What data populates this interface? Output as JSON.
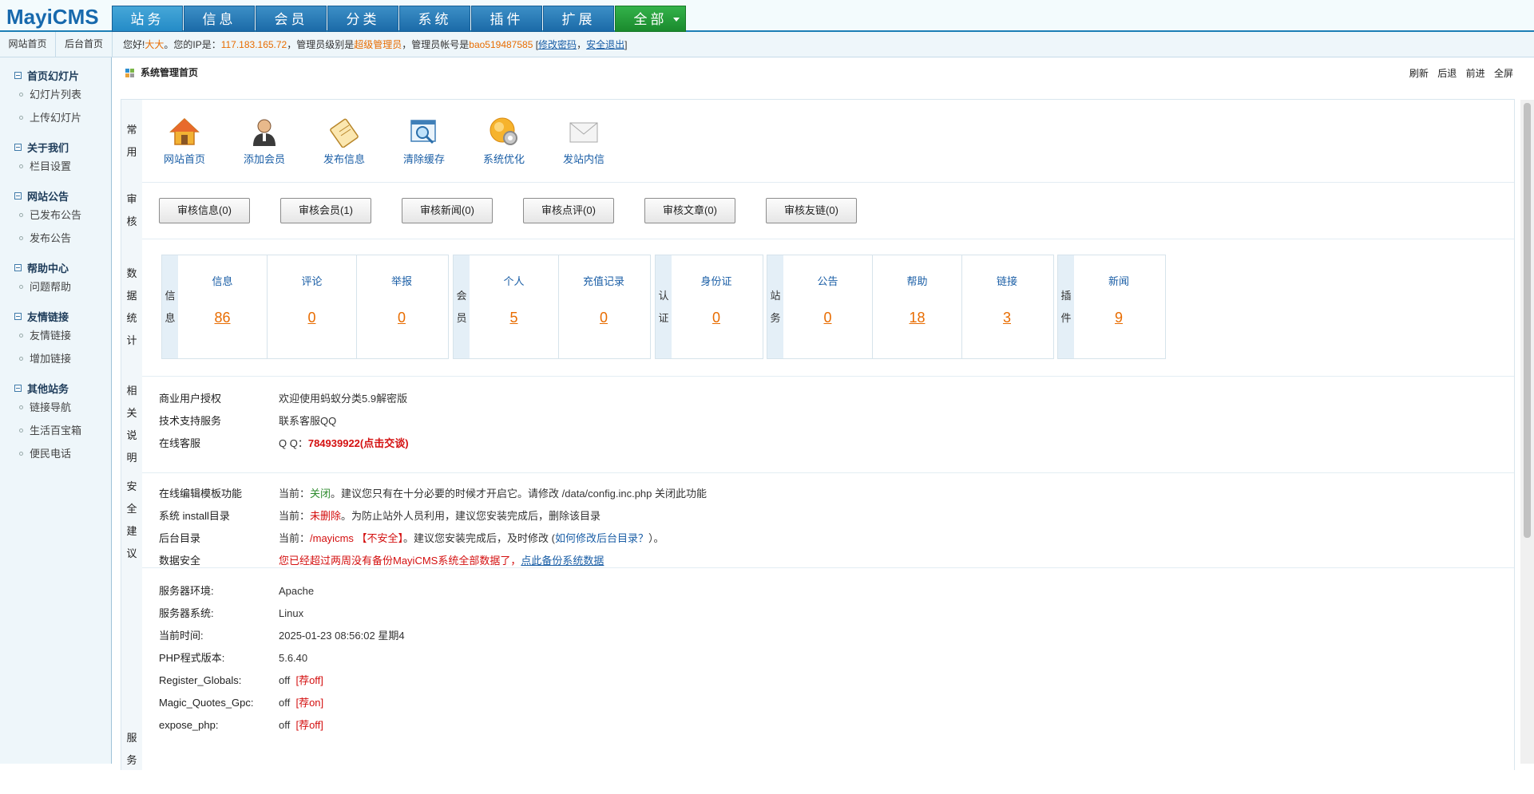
{
  "app": {
    "logo": "MayiCMS"
  },
  "main_nav": [
    {
      "label": "站务",
      "active": true
    },
    {
      "label": "信息"
    },
    {
      "label": "会员"
    },
    {
      "label": "分类"
    },
    {
      "label": "系统"
    },
    {
      "label": "插件"
    },
    {
      "label": "扩展"
    },
    {
      "label": "全部"
    }
  ],
  "sub_tabs": [
    "网站首页",
    "后台首页"
  ],
  "welcome": {
    "greeting": "您好!",
    "user": "大大",
    "ip_label": "。您的IP是：",
    "ip": "117.183.165.72",
    "level_label": "，管理员级别是",
    "level": "超级管理员",
    "account_label": "，管理员帐号是",
    "account": "bao519487585",
    "change_pwd": "修改密码",
    "logout": "安全退出",
    "bracket_open": " [",
    "sep": "，",
    "bracket_close": "]"
  },
  "sidebar": [
    {
      "title": "首页幻灯片",
      "items": [
        "幻灯片列表",
        "上传幻灯片"
      ]
    },
    {
      "title": "关于我们",
      "items": [
        "栏目设置"
      ]
    },
    {
      "title": "网站公告",
      "items": [
        "已发布公告",
        "发布公告"
      ]
    },
    {
      "title": "帮助中心",
      "items": [
        "问题帮助"
      ]
    },
    {
      "title": "友情链接",
      "items": [
        "友情链接",
        "增加链接"
      ]
    },
    {
      "title": "其他站务",
      "items": [
        "链接导航",
        "生活百宝箱",
        "便民电话"
      ]
    }
  ],
  "breadcrumb": {
    "title": "系统管理首页",
    "actions": [
      "刷新",
      "后退",
      "前进",
      "全屏"
    ]
  },
  "sections": {
    "common": {
      "label": [
        "常",
        "用"
      ],
      "links": [
        {
          "label": "网站首页",
          "icon": "house-icon"
        },
        {
          "label": "添加会员",
          "icon": "user-icon"
        },
        {
          "label": "发布信息",
          "icon": "clipboard-icon"
        },
        {
          "label": "清除缓存",
          "icon": "magnifier-window-icon"
        },
        {
          "label": "系统优化",
          "icon": "gear-globe-icon"
        },
        {
          "label": "发站内信",
          "icon": "envelope-icon"
        }
      ]
    },
    "audit": {
      "label": [
        "审",
        "核"
      ],
      "buttons": [
        "审核信息(0)",
        "审核会员(1)",
        "审核新闻(0)",
        "审核点评(0)",
        "审核文章(0)",
        "审核友链(0)"
      ]
    },
    "stats": {
      "label": [
        "数",
        "据",
        "统",
        "计"
      ],
      "groups": [
        {
          "label": [
            "信",
            "息"
          ],
          "cells": [
            {
              "title": "信息",
              "value": "86"
            },
            {
              "title": "评论",
              "value": "0"
            },
            {
              "title": "举报",
              "value": "0"
            }
          ]
        },
        {
          "label": [
            "会",
            "员"
          ],
          "cells": [
            {
              "title": "个人",
              "value": "5"
            },
            {
              "title": "充值记录",
              "value": "0"
            }
          ]
        },
        {
          "label": [
            "认",
            "证"
          ],
          "cells": [
            {
              "title": "身份证",
              "value": "0"
            }
          ]
        },
        {
          "label": [
            "站",
            "务"
          ],
          "cells": [
            {
              "title": "公告",
              "value": "0"
            },
            {
              "title": "帮助",
              "value": "18"
            },
            {
              "title": "链接",
              "value": "3"
            }
          ]
        },
        {
          "label": [
            "插",
            "件"
          ],
          "cells": [
            {
              "title": "新闻",
              "value": "9"
            }
          ]
        }
      ]
    },
    "about": {
      "label": [
        "相",
        "关",
        "说",
        "明"
      ],
      "rows": [
        {
          "key": "商业用户授权",
          "value": "欢迎使用蚂蚁分类5.9解密版"
        },
        {
          "key": "技术支持服务",
          "value": "联系客服QQ"
        },
        {
          "key": "在线客服",
          "prefix": "Q Q：",
          "value": "784939922(点击交谈)"
        }
      ]
    },
    "security": {
      "label": [
        "安",
        "全",
        "建",
        "议"
      ],
      "rows": [
        {
          "key": "在线编辑模板功能",
          "current": "当前：",
          "status": "关闭",
          "note": "。建议您只有在十分必要的时候才开启它。请修改 /data/config.inc.php 关闭此功能"
        },
        {
          "key": "系统 install目录",
          "current": "当前：",
          "status": "未删除",
          "note": "。为防止站外人员利用，建议您安装完成后，删除该目录"
        },
        {
          "key": "后台目录",
          "current": "当前：",
          "status": "/mayicms 【不安全】",
          "note": "。建议您安装完成后，及时修改 (",
          "link": "如何修改后台目录？",
          "tail": "）。"
        },
        {
          "key": "数据安全",
          "warning": "您已经超过两周没有备份MayiCMS系统全部数据了，",
          "link": "点此备份系统数据"
        }
      ]
    },
    "server": {
      "label": [
        "服",
        "务"
      ],
      "rows": [
        {
          "key": "服务器环境:",
          "value": "Apache"
        },
        {
          "key": "服务器系统:",
          "value": "Linux"
        },
        {
          "key": "当前时间:",
          "value": "2025-01-23 08:56:02 星期4"
        },
        {
          "key": "PHP程式版本:",
          "value": "5.6.40"
        },
        {
          "key": "Register_Globals:",
          "value": "off",
          "hint": "[荐off]"
        },
        {
          "key": "Magic_Quotes_Gpc:",
          "value": "off",
          "hint": "[荐on]"
        },
        {
          "key": "expose_php:",
          "value": "off",
          "hint": "[荐off]"
        }
      ]
    }
  },
  "colors": {
    "nav_blue": "#1b6aa8",
    "nav_green": "#1a8a2d",
    "accent_orange": "#e86c00",
    "warn_red": "#d41010"
  }
}
